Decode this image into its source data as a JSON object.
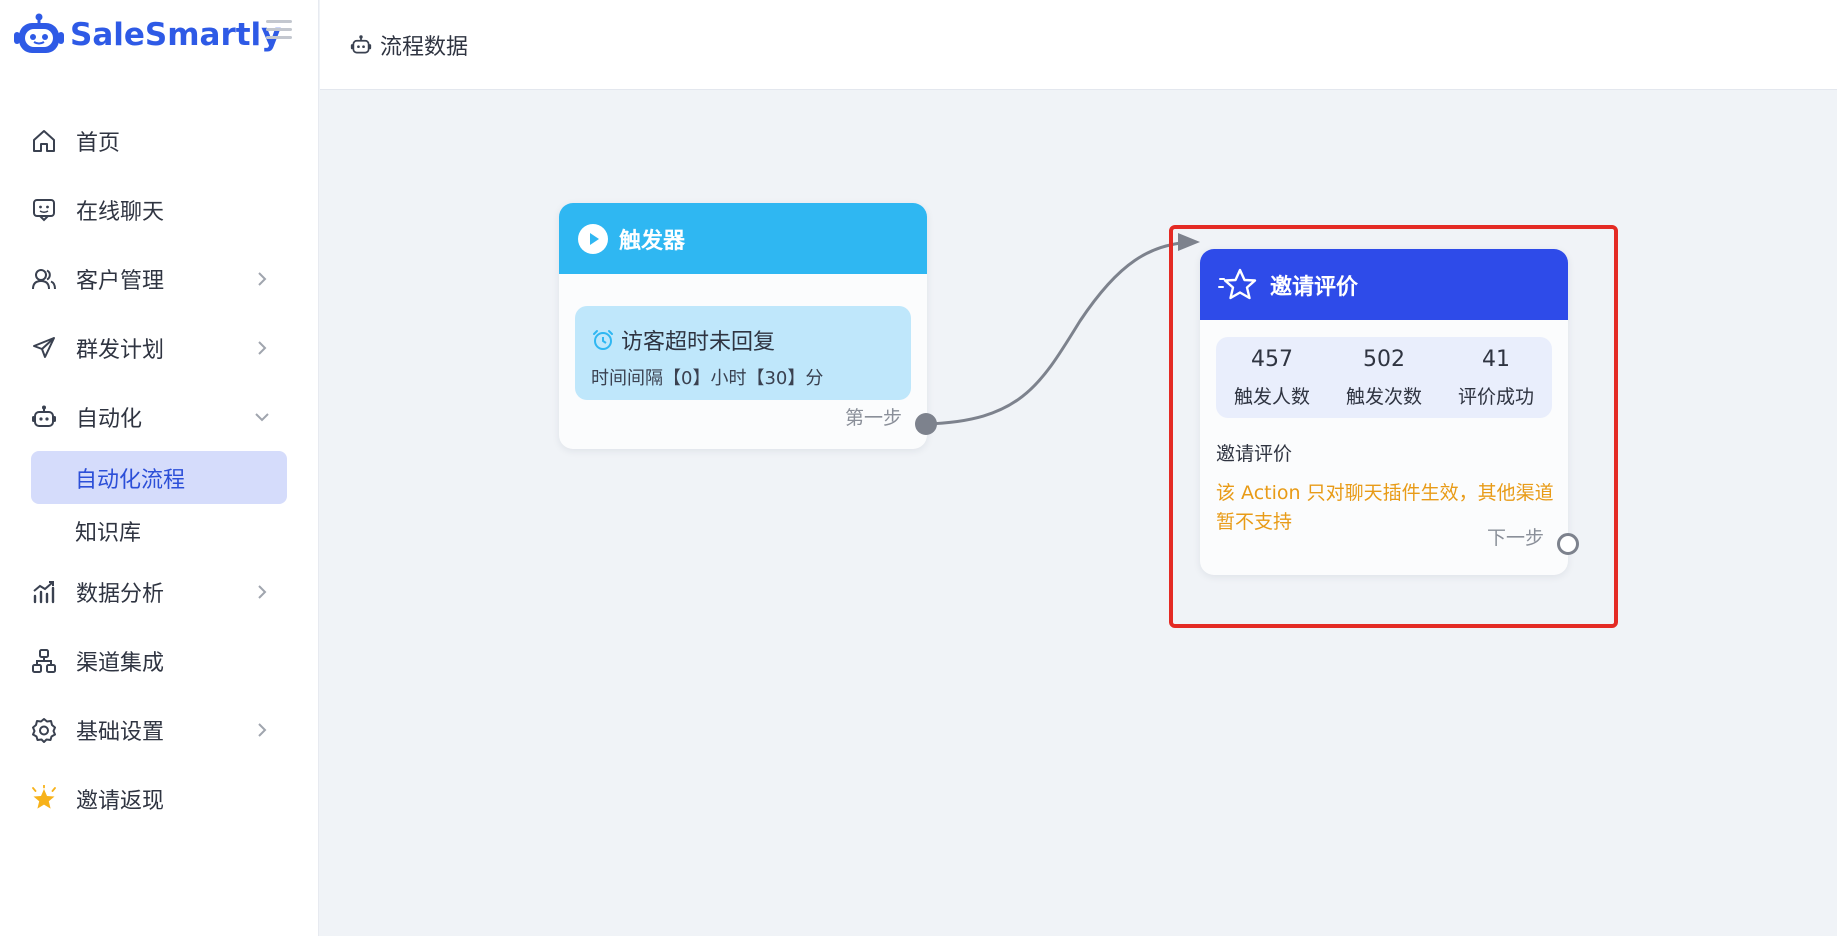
{
  "app": {
    "name": "SaleSmartly"
  },
  "header": {
    "title": "流程数据"
  },
  "sidebar": {
    "items": [
      {
        "label": "首页",
        "icon": "home-icon"
      },
      {
        "label": "在线聊天",
        "icon": "chat-icon"
      },
      {
        "label": "客户管理",
        "icon": "users-icon"
      },
      {
        "label": "群发计划",
        "icon": "send-icon"
      },
      {
        "label": "自动化",
        "icon": "robot-icon"
      },
      {
        "label": "数据分析",
        "icon": "chart-icon"
      },
      {
        "label": "渠道集成",
        "icon": "network-icon"
      },
      {
        "label": "基础设置",
        "icon": "gear-icon"
      },
      {
        "label": "邀请返现",
        "icon": "star-badge-icon"
      }
    ],
    "automation_sub": [
      {
        "label": "自动化流程",
        "active": true
      },
      {
        "label": "知识库",
        "active": false
      }
    ]
  },
  "flow": {
    "trigger": {
      "title": "触发器",
      "card_title": "访客超时未回复",
      "card_detail": "时间间隔【0】小时【30】分",
      "step_label": "第一步",
      "header_color": "#2fb7f2"
    },
    "invite": {
      "title": "邀请评价",
      "header_color": "#2e4be9",
      "stats": [
        {
          "value": "457",
          "label": "触发人数"
        },
        {
          "value": "502",
          "label": "触发次数"
        },
        {
          "value": "41",
          "label": "评价成功"
        }
      ],
      "section_label": "邀请评价",
      "warning": "该 Action 只对聊天插件生效，其他渠道暂不支持",
      "step_label": "下一步"
    }
  },
  "colors": {
    "brand": "#2e5ae6",
    "highlight": "#e42a24",
    "warning": "#e89b17"
  }
}
